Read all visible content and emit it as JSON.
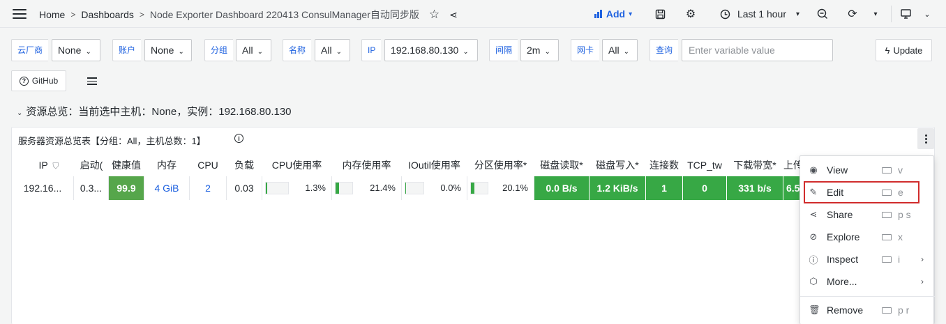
{
  "topbar": {
    "breadcrumb": [
      "Home",
      "Dashboards",
      "Node Exporter Dashboard 220413 ConsulManager自动同步版"
    ],
    "add_label": "Add",
    "time_range": "Last 1 hour"
  },
  "variables": [
    {
      "label": "云厂商",
      "value": "None"
    },
    {
      "label": "账户",
      "value": "None"
    },
    {
      "label": "分组",
      "value": "All"
    },
    {
      "label": "名称",
      "value": "All"
    },
    {
      "label": "IP",
      "value": "192.168.80.130"
    },
    {
      "label": "间隔",
      "value": "2m"
    },
    {
      "label": "网卡",
      "value": "All"
    }
  ],
  "query": {
    "label": "查询",
    "placeholder": "Enter variable value",
    "value": ""
  },
  "update_label": "Update",
  "github_label": "GitHub",
  "row_title": "资源总览：当前选中主机：None，实例：192.168.80.130",
  "panel": {
    "title": "服务器资源总览表【分组：All，主机总数：1】",
    "columns": [
      "IP",
      "启动(",
      "健康值",
      "内存",
      "CPU",
      "负载",
      "CPU使用率",
      "内存使用率",
      "IOutil使用率",
      "分区使用率*",
      "磁盘读取*",
      "磁盘写入*",
      "连接数",
      "TCP_tw",
      "下载带宽*",
      "上传"
    ],
    "row": {
      "ip": "192.16...",
      "uptime": "0.3...",
      "health": "99.9",
      "memory": "4 GiB",
      "cpu": "2",
      "load": "0.03",
      "cpu_usage": {
        "text": "1.3%",
        "fraction": 0.013
      },
      "mem_usage": {
        "text": "21.4%",
        "fraction": 0.214
      },
      "ioutil": {
        "text": "0.0%",
        "fraction": 0.0
      },
      "partition": {
        "text": "20.1%",
        "fraction": 0.201
      },
      "disk_read": "0.0 B/s",
      "disk_write": "1.2 KiB/s",
      "connections": "1",
      "tcp_tw": "0",
      "download": "331 b/s",
      "upload": "6.5"
    }
  },
  "menu": {
    "items": [
      {
        "label": "View",
        "shortcut": "v",
        "icon": "eye-icon"
      },
      {
        "label": "Edit",
        "shortcut": "e",
        "icon": "edit-icon"
      },
      {
        "label": "Share",
        "shortcut": "p s",
        "icon": "share-icon"
      },
      {
        "label": "Explore",
        "shortcut": "x",
        "icon": "compass-icon"
      },
      {
        "label": "Inspect",
        "shortcut": "i",
        "icon": "info-icon"
      },
      {
        "label": "More...",
        "shortcut": "",
        "icon": "cube-icon"
      },
      {
        "label": "Remove",
        "shortcut": "p r",
        "icon": "trash-icon"
      }
    ]
  },
  "colors": {
    "accent": "#1f62e0",
    "green": "#37a845",
    "highlight": "#d12c2c"
  }
}
